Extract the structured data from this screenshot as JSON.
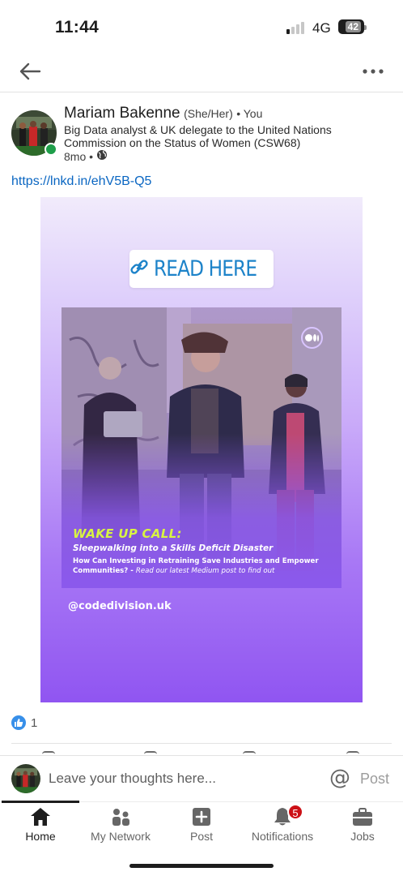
{
  "status_bar": {
    "time": "11:44",
    "network": "4G",
    "battery": "42"
  },
  "post": {
    "author": {
      "name": "Mariam Bakenne",
      "pronouns": "(She/Her)",
      "connection": "• You",
      "headline": "Big Data analyst & UK delegate to the United Nations Commission on the Status of Women (CSW68)",
      "time": "8mo •",
      "visibility_icon": "globe-icon"
    },
    "link": "https://lnkd.in/ehV5B-Q5",
    "image": {
      "button_text": "READ HERE",
      "title": "WAKE UP CALL:",
      "subtitle": "Sleepwalking into a Skills Deficit Disaster",
      "body_bold": "How Can Investing in Retraining Save Industries and Empower Communities? -",
      "body_italic": "Read our latest Medium post to find out",
      "handle": "@codedivision.uk"
    },
    "reactions": {
      "count": "1"
    }
  },
  "comment_bar": {
    "placeholder": "Leave your thoughts here...",
    "at_symbol": "@",
    "post_label": "Post"
  },
  "bottom_nav": {
    "items": [
      {
        "label": "Home",
        "icon": "home-icon"
      },
      {
        "label": "My Network",
        "icon": "network-icon"
      },
      {
        "label": "Post",
        "icon": "post-icon"
      },
      {
        "label": "Notifications",
        "icon": "bell-icon",
        "badge": "5"
      },
      {
        "label": "Jobs",
        "icon": "briefcase-icon"
      }
    ]
  },
  "colors": {
    "link": "#0a66c2",
    "online": "#1e9e4a",
    "badge": "#cc1016",
    "headline_green": "#d8f442"
  }
}
